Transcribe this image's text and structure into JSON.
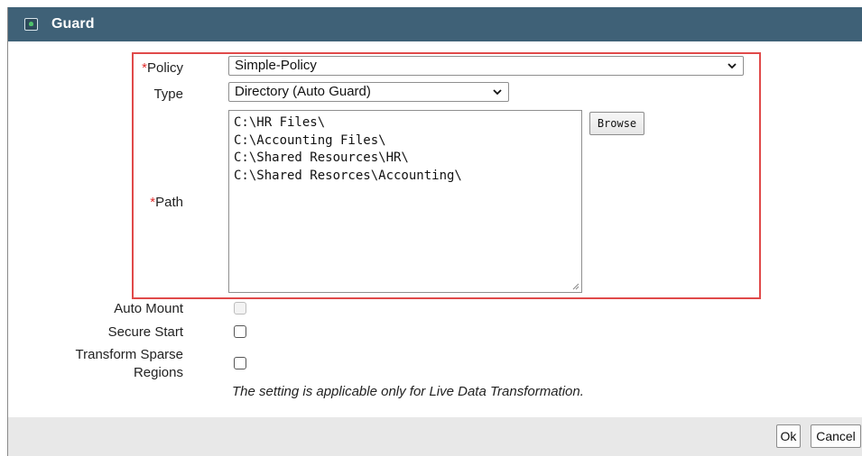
{
  "dialog": {
    "title": "Guard",
    "title_icon": "guard-shield-icon"
  },
  "form": {
    "required_marker": "*",
    "policy": {
      "label": "Policy",
      "value": "Simple-Policy"
    },
    "type": {
      "label": "Type",
      "value": "Directory (Auto Guard)"
    },
    "path": {
      "label": "Path",
      "lines": [
        "C:\\HR Files\\",
        "C:\\Accounting Files\\",
        "C:\\Shared Resources\\HR\\",
        "C:\\Shared Resorces\\Accounting\\"
      ],
      "browse_label": "Browse"
    },
    "auto_mount": {
      "label": "Auto Mount",
      "checked": false,
      "disabled": true
    },
    "secure_start": {
      "label": "Secure Start",
      "checked": false
    },
    "transform_sparse": {
      "label_line1": "Transform Sparse",
      "label_line2": "Regions",
      "checked": false
    },
    "note": "The setting is applicable only for Live Data Transformation."
  },
  "footer": {
    "ok_label": "Ok",
    "cancel_label": "Cancel"
  },
  "colors": {
    "titlebar": "#3f6177",
    "highlight_border": "#e04a4a",
    "required": "#e02b2b",
    "footer": "#e8e8e8"
  }
}
